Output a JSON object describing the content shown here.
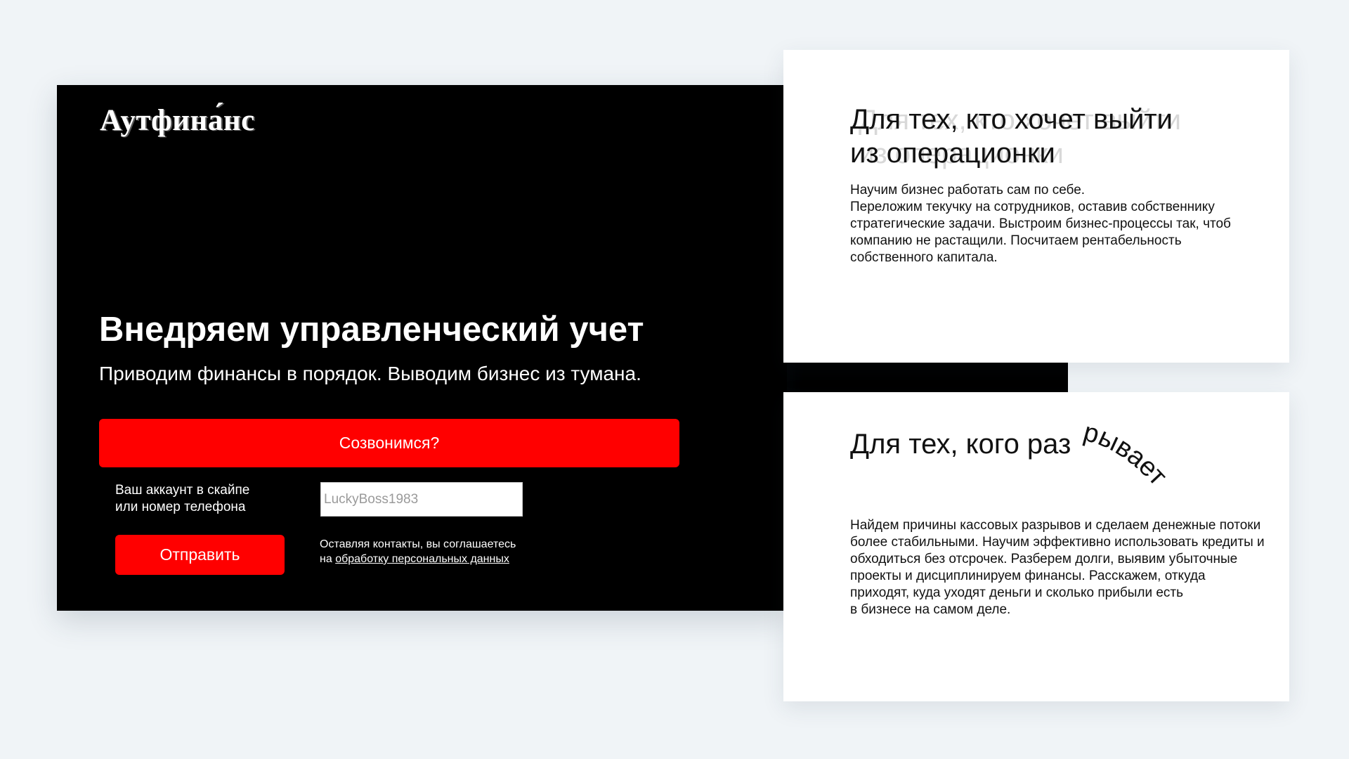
{
  "hero": {
    "logo": "Аутфина́нс",
    "title": "Внедряем управленческий учет",
    "subtitle": "Приводим финансы в порядок. Выводим бизнес из тумана.",
    "cta_label": "Созвонимся?",
    "contact_label_line1": "Ваш аккаунт в скайпе",
    "contact_label_line2": "или номер телефона",
    "contact_placeholder": "LuckyBoss1983",
    "contact_value": "",
    "send_label": "Отправить",
    "consent_line1": "Оставляя контакты, вы соглашаетесь",
    "consent_prefix": "на ",
    "consent_link": "обработку персональных данных"
  },
  "card1": {
    "title_line1": "Для тех, кто хочет выйти",
    "title_line2": "из операционки",
    "paragraph1": "Научим бизнес работать сам по себе.",
    "paragraph2": "Переложим текучку на сотрудников, оставив собственнику стратегические задачи. Выстроим бизнес-процессы так, чтоб компанию не растащили. Посчитаем рентабельность собственного капитала."
  },
  "card2": {
    "title_prefix": "Для тех, кого раз",
    "title_curved": "рывает",
    "paragraph1": "Найдем причины кассовых разрывов и сделаем денежные потоки более стабильными. Научим эффективно использовать кредиты и обходиться без отсрочек. Разберем долги, выявим убыточные проекты и дисциплинируем финансы. Расскажем, откуда приходят, куда уходят деньги и сколько прибыли есть",
    "paragraph2": "в бизнесе на самом деле."
  },
  "colors": {
    "accent": "#ff0000",
    "hero_bg": "#000000",
    "page_bg": "#f0f4f7",
    "card_bg": "#ffffff"
  }
}
